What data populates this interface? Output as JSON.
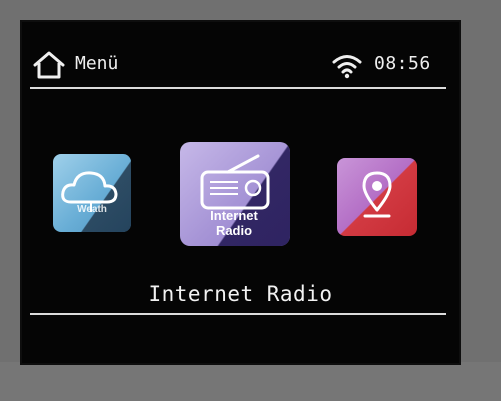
{
  "header": {
    "menu_label": "Menü",
    "time": "08:56",
    "icons": [
      "home-icon",
      "wifi-icon"
    ]
  },
  "menu": {
    "items": [
      {
        "id": "weather",
        "icon": "cloud-icon",
        "caption": "Weath"
      },
      {
        "id": "internet-radio",
        "icon": "radio-icon",
        "caption_line1": "Internet",
        "caption_line2": "Radio"
      },
      {
        "id": "location",
        "icon": "map-pin-icon"
      }
    ],
    "selected_title": "Internet Radio"
  },
  "colors": {
    "screen_background": "#050505",
    "bezel": "#707070",
    "text": "#efefef",
    "weather_tile": "#69aed6",
    "radio_tile": "#a694d6",
    "location_tile_top": "#b46fc6",
    "location_tile_bottom": "#c62b33"
  }
}
